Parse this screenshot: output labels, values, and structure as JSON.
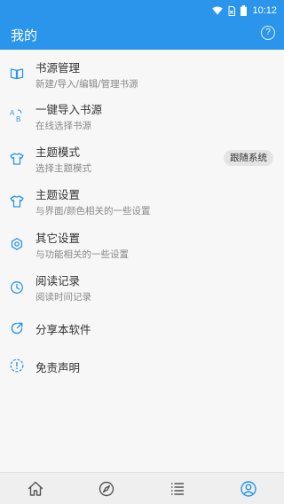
{
  "status": {
    "time": "10:12"
  },
  "appbar": {
    "title": "我的"
  },
  "menu": [
    {
      "title": "书源管理",
      "subtitle": "新建/导入/编辑/管理书源"
    },
    {
      "title": "一键导入书源",
      "subtitle": "在线选择书源"
    },
    {
      "title": "主题模式",
      "subtitle": "选择主题模式",
      "badge": "跟随系统"
    },
    {
      "title": "主题设置",
      "subtitle": "与界面/颜色相关的一些设置"
    },
    {
      "title": "其它设置",
      "subtitle": "与功能相关的一些设置"
    },
    {
      "title": "阅读记录",
      "subtitle": "阅读时间记录"
    },
    {
      "title": "分享本软件"
    },
    {
      "title": "免责声明"
    }
  ],
  "icons": {
    "accent": "#2a95ea",
    "menu": [
      "book-icon",
      "ab-translate-icon",
      "tshirt-icon",
      "tshirt-icon",
      "gear-icon",
      "clock-icon",
      "share-icon",
      "info-icon"
    ],
    "nav": [
      "home-icon",
      "explore-icon",
      "list-icon",
      "profile-icon"
    ]
  },
  "bottom_nav": {
    "active_index": 3
  }
}
